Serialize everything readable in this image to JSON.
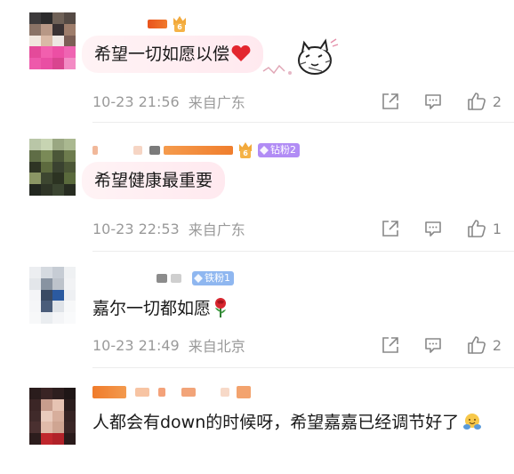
{
  "comments": [
    {
      "text": "希望一切如愿以偿",
      "time": "10-23 21:56",
      "location": "来自广东",
      "likes": "2",
      "fan_badge": null,
      "vip_level": "6"
    },
    {
      "text": "希望健康最重要",
      "time": "10-23 22:53",
      "location": "来自广东",
      "likes": "1",
      "fan_badge": "钻粉2",
      "vip_level": "6"
    },
    {
      "text": "嘉尔一切都如愿",
      "time": "10-23 21:49",
      "location": "来自北京",
      "likes": "2",
      "fan_badge": "铁粉1",
      "vip_level": null
    },
    {
      "text": "人都会有down的时候呀，希望嘉嘉已经调节好了",
      "time": null,
      "location": null,
      "likes": null,
      "fan_badge": null,
      "vip_level": null
    }
  ],
  "icons": {
    "share": "share-icon",
    "reply": "comment-icon",
    "like": "thumbs-up-icon",
    "vip": "vip-crown-icon",
    "heart": "red-heart-emoji",
    "rose": "rose-emoji",
    "hug": "hug-emoji"
  },
  "colors": {
    "meta_text": "#9a9a9a",
    "bubble_bg": "#f6f6f6",
    "diamond_fan": "#b18cf5",
    "iron_fan": "#8fb7f0",
    "vip": "#f5b347"
  }
}
